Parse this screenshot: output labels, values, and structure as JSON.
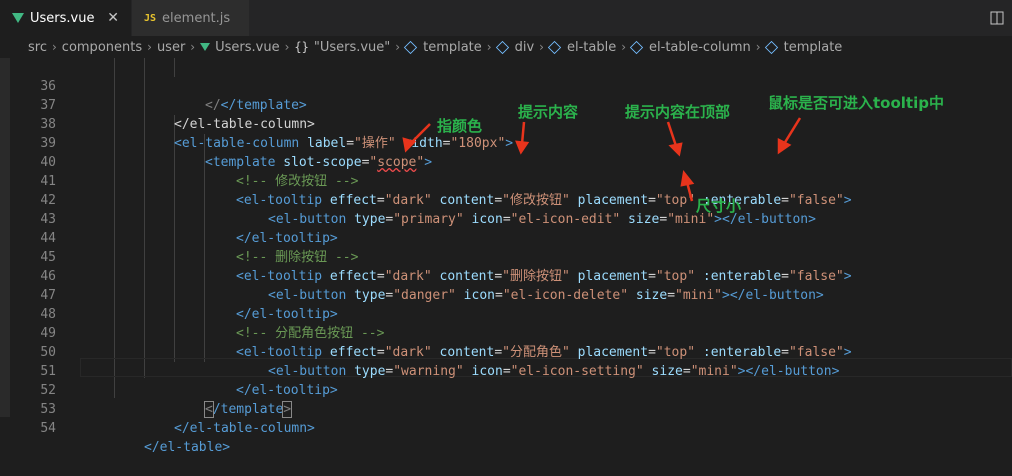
{
  "tabs": [
    {
      "label": "Users.vue",
      "icon": "vue-icon",
      "active": true,
      "close": "✕"
    },
    {
      "label": "element.js",
      "icon_text": "JS",
      "active": false
    }
  ],
  "breadcrumb": {
    "items": [
      "src",
      "components",
      "user",
      "Users.vue",
      "\"Users.vue\"",
      "template",
      "div",
      "el-table",
      "el-table-column",
      "template"
    ],
    "braces": "{}"
  },
  "editor": {
    "lines": [
      {
        "n": "36"
      },
      {
        "n": "37"
      },
      {
        "n": "38"
      },
      {
        "n": "39"
      },
      {
        "n": "40"
      },
      {
        "n": "41"
      },
      {
        "n": "42"
      },
      {
        "n": "43"
      },
      {
        "n": "44"
      },
      {
        "n": "45"
      },
      {
        "n": "46"
      },
      {
        "n": "47"
      },
      {
        "n": "48"
      },
      {
        "n": "49"
      },
      {
        "n": "50"
      },
      {
        "n": "51"
      },
      {
        "n": "52"
      },
      {
        "n": "53"
      },
      {
        "n": "54"
      }
    ],
    "code": {
      "l36": "</template>",
      "l37": "</el-table-column>",
      "l38": {
        "open": "<el-table-column ",
        "a1": "label",
        "v1": "\"操作\"",
        "a2": " width",
        "v2": "\"180px\"",
        "close": ">"
      },
      "l39": {
        "open": "<template ",
        "a1": "slot-scope",
        "v1a": "\"",
        "v1b": "scope",
        "v1c": "\"",
        "close": ">"
      },
      "l40": "<!-- 修改按钮 -->",
      "l41": {
        "open": "<el-tooltip ",
        "a1": "effect",
        "v1": "\"dark\"",
        "a2": " content",
        "v2": "\"修改按钮\"",
        "a3": " placement",
        "v3": "\"top\"",
        "a4": " :enterable",
        "v4": "\"false\"",
        "close": ">"
      },
      "l42": {
        "open": "<el-button ",
        "a1": "type",
        "v1": "\"primary\"",
        "a2": " icon",
        "v2": "\"el-icon-edit\"",
        "a3": " size",
        "v3": "\"mini\"",
        "close": "></el-button>"
      },
      "l43": "</el-tooltip>",
      "l44": "<!-- 删除按钮 -->",
      "l45": {
        "open": "<el-tooltip ",
        "a1": "effect",
        "v1": "\"dark\"",
        "a2": " content",
        "v2": "\"删除按钮\"",
        "a3": " placement",
        "v3": "\"top\"",
        "a4": " :enterable",
        "v4": "\"false\"",
        "close": ">"
      },
      "l46": {
        "open": "<el-button ",
        "a1": "type",
        "v1": "\"danger\"",
        "a2": " icon",
        "v2": "\"el-icon-delete\"",
        "a3": " size",
        "v3": "\"mini\"",
        "close": "></el-button>"
      },
      "l47": "</el-tooltip>",
      "l48": "<!-- 分配角色按钮 -->",
      "l49": {
        "open": "<el-tooltip ",
        "a1": "effect",
        "v1": "\"dark\"",
        "a2": " content",
        "v2": "\"分配角色\"",
        "a3": " placement",
        "v3": "\"top\"",
        "a4": " :enterable",
        "v4": "\"false\"",
        "close": ">"
      },
      "l50": {
        "open": "<el-button ",
        "a1": "type",
        "v1": "\"warning\"",
        "a2": " icon",
        "v2": "\"el-icon-setting\"",
        "a3": " size",
        "v3": "\"mini\"",
        "close": "></el-button>"
      },
      "l51": "</el-tooltip>",
      "l52": {
        "lt": "<",
        "rest": "/template",
        "gt": ">"
      },
      "l53": "</el-table-column>",
      "l54": "</el-table>"
    }
  },
  "annotations": {
    "theme_color": "指颜色",
    "hint_content": "提示内容",
    "hint_placement": "提示内容在顶部",
    "enterable": "鼠标是否可进入tooltip中",
    "size": "尺寸小",
    "color": "#2bb24c",
    "arrow_color": "#e8341c"
  }
}
